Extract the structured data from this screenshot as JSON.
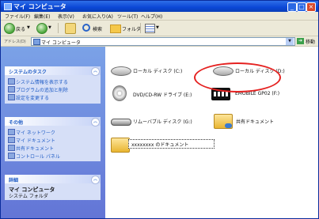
{
  "window": {
    "title": "マイ コンピュータ"
  },
  "menu": [
    "ファイル(F)",
    "編集(E)",
    "表示(V)",
    "お気に入り(A)",
    "ツール(T)",
    "ヘルプ(H)"
  ],
  "toolbar": {
    "back": "戻る",
    "search": "検索",
    "folders": "フォルダ"
  },
  "address": {
    "label": "アドレス(D)",
    "value": "マイ コンピュータ",
    "go": "移動"
  },
  "sidebar": {
    "system_tasks": {
      "title": "システムのタスク",
      "items": [
        "システム情報を表示する",
        "プログラムの追加と削除",
        "設定を変更する"
      ]
    },
    "other_places": {
      "title": "その他",
      "items": [
        "マイ ネットワーク",
        "マイ ドキュメント",
        "共有ドキュメント",
        "コントロール パネル"
      ]
    },
    "details": {
      "title": "詳細",
      "name": "マイ コンピュータ",
      "sub": "システム フォルダ"
    }
  },
  "content": {
    "items": [
      {
        "label": "ローカル ディスク (C:)",
        "icon": "hard-disk-icon"
      },
      {
        "label": "ローカル ディスク (D:)",
        "icon": "hard-disk-icon"
      },
      {
        "label": "DVD/CD-RW ドライブ (E:)",
        "icon": "dvd-drive-icon"
      },
      {
        "label": "EMOBILE GP02 (F:)",
        "icon": "emobile-icon"
      },
      {
        "label": "リムーバブル ディスク (G:)",
        "icon": "removable-disk-icon"
      },
      {
        "label": "共有ドキュメント",
        "icon": "shared-folder-icon"
      },
      {
        "label": "xxxxxxxx のドキュメント",
        "icon": "folder-icon"
      }
    ]
  },
  "colors": {
    "highlight": "#e52221",
    "sidebar": "#7ba2e7",
    "titlebar": "#0b47d6"
  }
}
